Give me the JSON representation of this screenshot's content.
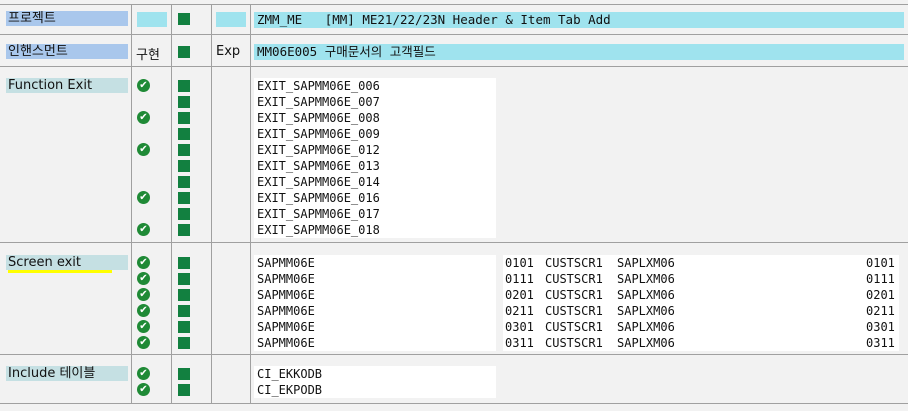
{
  "header": {
    "project_label": "프로젝트",
    "project_title": "ZMM_ME   [MM] ME21/22/23N Header & Item Tab Add",
    "enhancement_label": "인핸스먼트",
    "impl_label": "구현",
    "exp_label": "Exp",
    "enhancement_title": "MM06E005 구매문서의 고객필드"
  },
  "function_exit": {
    "label": "Function Exit",
    "items": [
      {
        "name": "EXIT_SAPMM06E_006",
        "implemented": true
      },
      {
        "name": "EXIT_SAPMM06E_007",
        "implemented": false
      },
      {
        "name": "EXIT_SAPMM06E_008",
        "implemented": true
      },
      {
        "name": "EXIT_SAPMM06E_009",
        "implemented": false
      },
      {
        "name": "EXIT_SAPMM06E_012",
        "implemented": true
      },
      {
        "name": "EXIT_SAPMM06E_013",
        "implemented": false
      },
      {
        "name": "EXIT_SAPMM06E_014",
        "implemented": false
      },
      {
        "name": "EXIT_SAPMM06E_016",
        "implemented": true
      },
      {
        "name": "EXIT_SAPMM06E_017",
        "implemented": false
      },
      {
        "name": "EXIT_SAPMM06E_018",
        "implemented": true
      }
    ]
  },
  "screen_exit": {
    "label": "Screen exit",
    "rows": [
      {
        "program": "SAPMM06E",
        "screen": "0101",
        "area": "CUSTSCR1",
        "called_prog": "SAPLXM06",
        "called_screen": "0101"
      },
      {
        "program": "SAPMM06E",
        "screen": "0111",
        "area": "CUSTSCR1",
        "called_prog": "SAPLXM06",
        "called_screen": "0111"
      },
      {
        "program": "SAPMM06E",
        "screen": "0201",
        "area": "CUSTSCR1",
        "called_prog": "SAPLXM06",
        "called_screen": "0201"
      },
      {
        "program": "SAPMM06E",
        "screen": "0211",
        "area": "CUSTSCR1",
        "called_prog": "SAPLXM06",
        "called_screen": "0211"
      },
      {
        "program": "SAPMM06E",
        "screen": "0301",
        "area": "CUSTSCR1",
        "called_prog": "SAPLXM06",
        "called_screen": "0301"
      },
      {
        "program": "SAPMM06E",
        "screen": "0311",
        "area": "CUSTSCR1",
        "called_prog": "SAPLXM06",
        "called_screen": "0311"
      }
    ]
  },
  "include_table": {
    "label": "Include 테이블",
    "items": [
      {
        "name": "CI_EKKODB",
        "implemented": true
      },
      {
        "name": "CI_EKPODB",
        "implemented": true
      }
    ]
  },
  "colors": {
    "label_blue": "#a9c7ec",
    "label_teal": "#c5e0e3",
    "cyan_field": "#9fe3ee",
    "check_green": "#1f8a36",
    "square_green": "#128040",
    "highlight_yellow": "#ffff00"
  },
  "icons": {
    "implemented": "check-circle-icon",
    "status": "green-square-icon"
  }
}
